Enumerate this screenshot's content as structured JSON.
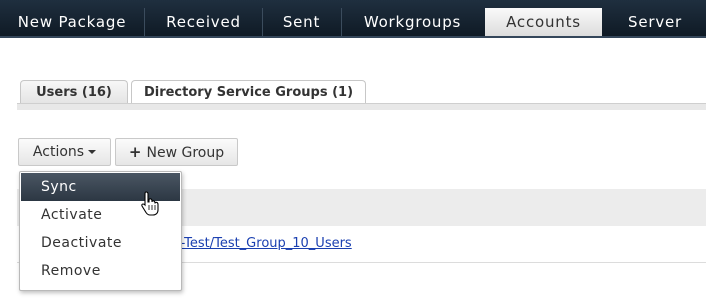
{
  "topnav": {
    "tabs": [
      {
        "label": "New Package"
      },
      {
        "label": "Received"
      },
      {
        "label": "Sent"
      },
      {
        "label": "Workgroups"
      },
      {
        "label": "Accounts"
      },
      {
        "label": "Server"
      }
    ],
    "active_tab": "Accounts"
  },
  "subtabs": [
    {
      "label": "Users (16)"
    },
    {
      "label": "Directory Service Groups (1)"
    }
  ],
  "toolbar": {
    "actions_label": "Actions",
    "new_group_label": "New Group"
  },
  "actions_menu": {
    "items": [
      {
        "label": "Sync"
      },
      {
        "label": "Activate"
      },
      {
        "label": "Deactivate"
      },
      {
        "label": "Remove"
      }
    ],
    "hovered_item": "Sync"
  },
  "table": {
    "rows": [
      {
        "name": "A-Test/Test_Group_10_Users"
      }
    ]
  },
  "colors": {
    "nav_bg": "#132230",
    "active_tab_bg": "#e6e6e6",
    "hover_bg": "#37434f",
    "link": "#1a3fb0"
  },
  "icons": {
    "actions_caret": "caret-down-icon",
    "new_group": "plus-icon",
    "pointer": "hand-pointer-icon"
  }
}
